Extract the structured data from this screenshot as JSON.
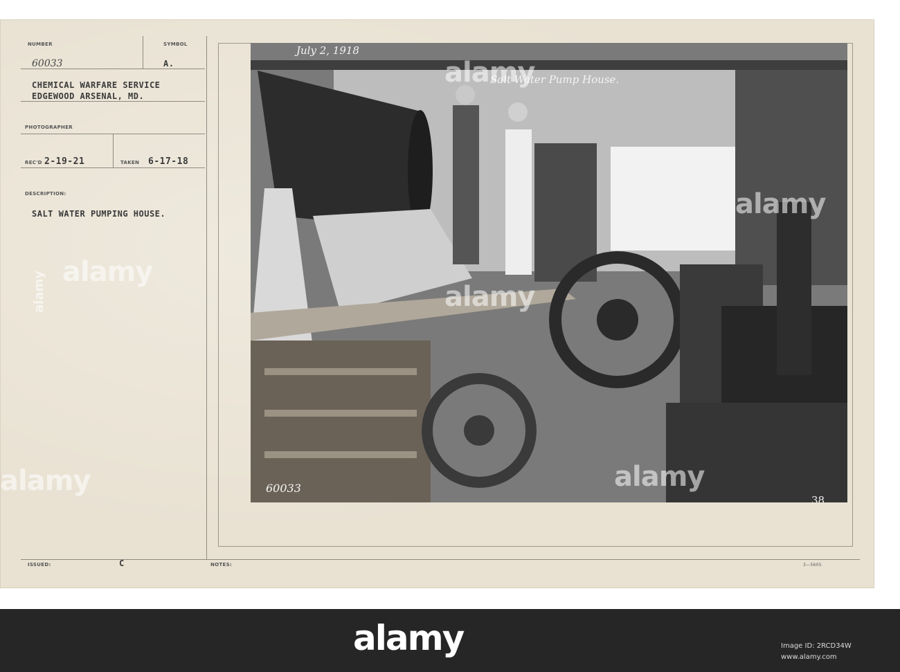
{
  "card": {
    "number_label": "NUMBER",
    "number_value": "60033",
    "symbol_label": "SYMBOL",
    "symbol_value": "A.",
    "org_line1": "CHEMICAL WARFARE SERVICE",
    "org_line2": "EDGEWOOD ARSENAL, MD.",
    "photographer_label": "PHOTOGRAPHER",
    "recd_label": "REC'D",
    "recd_value": "2-19-21",
    "taken_label": "TAKEN",
    "taken_value": "6-17-18",
    "description_label": "DESCRIPTION:",
    "description_value": "SALT WATER PUMPING HOUSE.",
    "issued_label": "ISSUED:",
    "issued_value": "C",
    "notes_label": "NOTES:",
    "form_code": "3—5605"
  },
  "photo": {
    "date_caption": "July 2, 1918",
    "title_caption": "Salt Water Pump House.",
    "negative_number": "60033",
    "plate_number": "38."
  },
  "watermark": {
    "word": "alamy"
  },
  "footer": {
    "logo": "alamy",
    "image_id": "Image ID: 2RCD34W",
    "site": "www.alamy.com"
  },
  "colors": {
    "card": "#e9e2d3",
    "band": "#262626",
    "ink": "#3a3a3a"
  }
}
